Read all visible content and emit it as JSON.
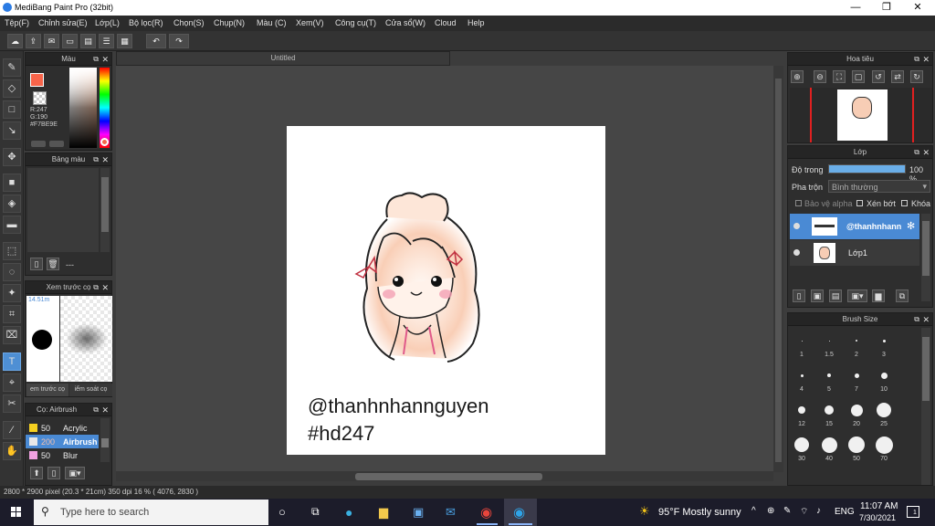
{
  "window": {
    "title": "MediBang Paint Pro (32bit)",
    "min": "—",
    "max": "❐",
    "close": "✕"
  },
  "menu": [
    "Tệp(F)",
    "Chỉnh sửa(E)",
    "Lớp(L)",
    "Bộ lọc(R)",
    "Chọn(S)",
    "Chụp(N)",
    "Màu (C)",
    "Xem(V)",
    "Công cụ(T)",
    "Cửa sổ(W)",
    "Cloud",
    "Help"
  ],
  "toolbar_icons": [
    "cloud-icon",
    "upload-icon",
    "comment-icon",
    "page-icon",
    "pages-icon",
    "list-icon",
    "grid-icon",
    "undo-icon",
    "redo-icon"
  ],
  "color_panel": {
    "title": "Màu",
    "r": "R:247",
    "g": "G:190",
    "hex": "#F7BE9E",
    "fg_color": "#F7644A",
    "bg_color": "#FFFFFF"
  },
  "palette_panel": {
    "title": "Bảng màu",
    "dash": "---"
  },
  "preview_panel": {
    "title": "Xem trước cọ",
    "size": "14.51m",
    "tab1": "em trước cọ",
    "tab2": "iểm soát cọ"
  },
  "brush_panel": {
    "title": "Cọ: Airbrush",
    "items": [
      {
        "size": "50",
        "name": "Acrylic",
        "color": "#f5d020"
      },
      {
        "size": "200",
        "name": "Airbrush",
        "color": "#e8e8e8"
      },
      {
        "size": "50",
        "name": "Blur",
        "color": "#f0a0e0"
      }
    ]
  },
  "document": {
    "tab": "Untitled",
    "text1": "@thanhnhannguyen",
    "text2": "#hd247"
  },
  "navigator": {
    "title": "Hoa tiêu"
  },
  "layer_panel": {
    "title": "Lớp",
    "opacity_label": "Độ trong",
    "opacity_value": "100 %",
    "opacity": 1.0,
    "blend_label": "Pha trộn",
    "blend_value": "Bình thường",
    "protect_alpha": "Bảo vệ alpha",
    "clip": "Xén bớt",
    "lock": "Khóa",
    "layers": [
      {
        "name": "@thanhnhann",
        "selected": true
      },
      {
        "name": "Lớp1",
        "selected": false
      }
    ]
  },
  "brush_size": {
    "title": "Brush Size",
    "sizes": [
      "1",
      "1.5",
      "2",
      "3",
      "4",
      "5",
      "7",
      "10",
      "12",
      "15",
      "20",
      "25",
      "30",
      "40",
      "50",
      "70"
    ]
  },
  "status": {
    "text": "2800 * 2900 pixel  (20.3 * 21cm)  350 dpi  16 %  ( 4076, 2830 )"
  },
  "taskbar": {
    "search_placeholder": "Type here to search",
    "weather": "95°F  Mostly sunny",
    "lang": "ENG",
    "time": "11:07 AM",
    "date": "7/30/2021",
    "notif": "1"
  }
}
